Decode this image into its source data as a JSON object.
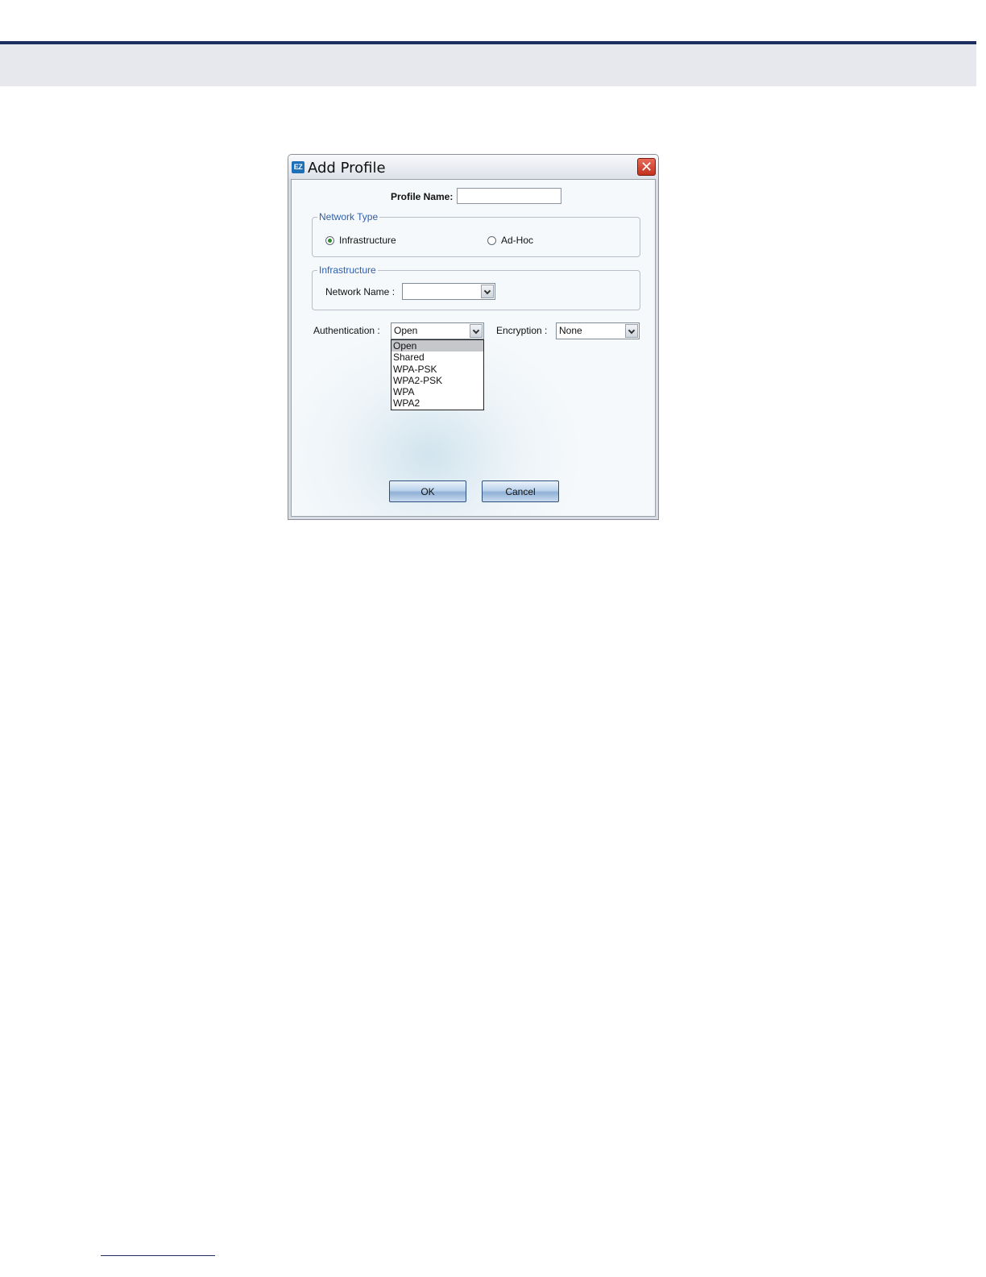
{
  "dialog": {
    "title": "Add Profile",
    "app_icon_text": "EZ",
    "close_symbol": "✕"
  },
  "profile": {
    "label": "Profile Name:",
    "value": ""
  },
  "network_type": {
    "legend": "Network Type",
    "options": [
      {
        "label": "Infrastructure",
        "checked": true
      },
      {
        "label": "Ad-Hoc",
        "checked": false
      }
    ]
  },
  "infrastructure": {
    "legend": "Infrastructure",
    "network_name_label": "Network Name :",
    "network_name_value": ""
  },
  "authentication": {
    "label": "Authentication :",
    "value": "Open",
    "options": [
      "Open",
      "Shared",
      "WPA-PSK",
      "WPA2-PSK",
      "WPA",
      "WPA2"
    ],
    "highlighted": "Open"
  },
  "encryption": {
    "label": "Encryption :",
    "value": "None"
  },
  "buttons": {
    "ok": "OK",
    "cancel": "Cancel"
  },
  "icons": [
    "app-icon",
    "close-icon",
    "chevron-down-icon",
    "radio-icon"
  ],
  "colors": {
    "header_rule": "#1c2f5e",
    "header_band": "#e6e8ee",
    "legend_text": "#2e5fa8",
    "close_button": "#c2321f"
  }
}
